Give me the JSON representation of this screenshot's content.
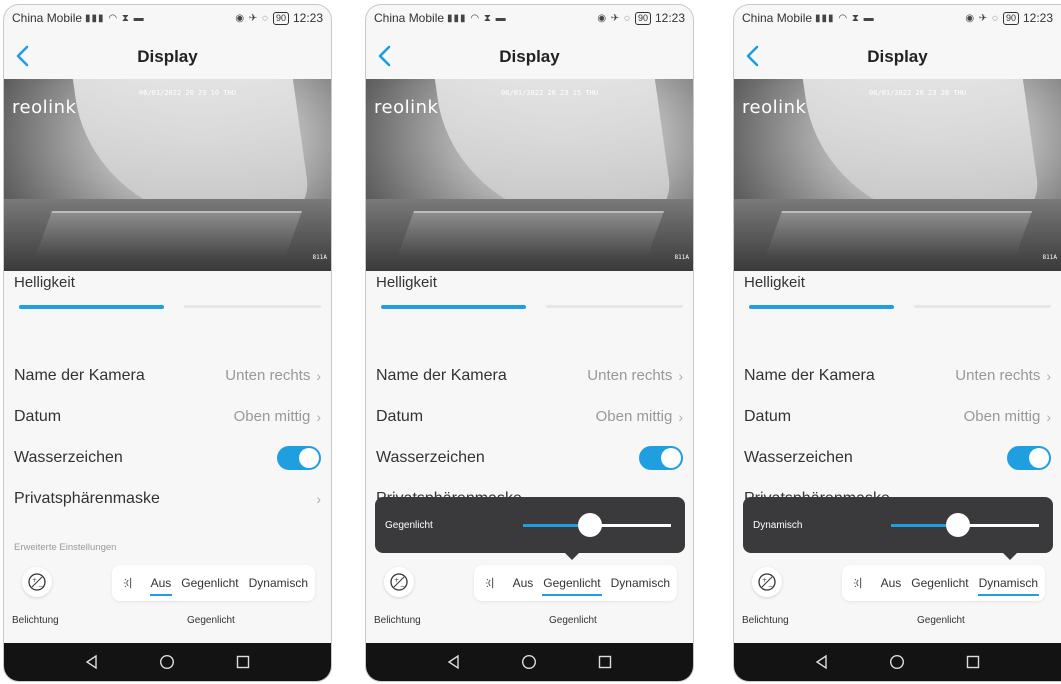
{
  "status": {
    "carrier": "China Mobile",
    "time": "12:23",
    "battery": "90"
  },
  "nav": {
    "title": "Display"
  },
  "video": {
    "logo": "reolink",
    "camera_id": "811A"
  },
  "brightness_label": "Helligkeit",
  "brightness": 0.44,
  "rows": {
    "camera_name": {
      "label": "Name der Kamera",
      "value": "Unten rechts"
    },
    "date": {
      "label": "Datum",
      "value": "Oben mittig"
    },
    "watermark": {
      "label": "Wasserzeichen",
      "on": true
    },
    "privacy": {
      "label": "Privatsphärenmaske"
    }
  },
  "advanced_title": "Erweiterte Einstellungen",
  "backlight_options": [
    "Aus",
    "Gegenlicht",
    "Dynamisch"
  ],
  "exposure_caption": "Belichtung",
  "backlight_caption": "Gegenlicht",
  "screens": [
    {
      "timestamp": "06/01/2022 20 23 10 THU",
      "selected": 0,
      "popover": null
    },
    {
      "timestamp": "06/01/2022 20 23 15 THU",
      "selected": 1,
      "popover": {
        "label": "Gegenlicht",
        "level": 0.45
      }
    },
    {
      "timestamp": "06/01/2022 20 23 20 THU",
      "selected": 2,
      "popover": {
        "label": "Dynamisch",
        "level": 0.45
      }
    }
  ],
  "colors": {
    "accent": "#1f9ee0",
    "popover_bg": "#3a3a3c",
    "nav_bar": "#131313"
  },
  "icons": {
    "back": "chevron-left-icon",
    "exposure": "exposure-icon",
    "backlight": "backlight-icon"
  }
}
